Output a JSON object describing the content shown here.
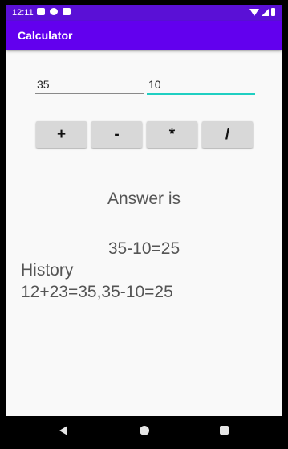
{
  "status_bar": {
    "time": "12:11",
    "icons_left": [
      "notification-icon",
      "notification-icon",
      "sd-card-icon"
    ],
    "icons_right": [
      "wifi-icon",
      "signal-icon",
      "battery-icon"
    ]
  },
  "app_bar": {
    "title": "Calculator",
    "color": "#6200ee"
  },
  "inputs": {
    "first_value": "35",
    "second_value": "10"
  },
  "operators": [
    "+",
    "-",
    "*",
    "/"
  ],
  "result": {
    "label": "Answer is",
    "value": "35-10=25"
  },
  "history": {
    "label": "History",
    "value": "12+23=35,35-10=25"
  },
  "nav_bar": {
    "icons": [
      "back-icon",
      "home-icon",
      "recents-icon"
    ]
  },
  "colors": {
    "accent": "#20cfc2",
    "button_bg": "#d8d8d8",
    "status_bar": "#5a10d6"
  }
}
